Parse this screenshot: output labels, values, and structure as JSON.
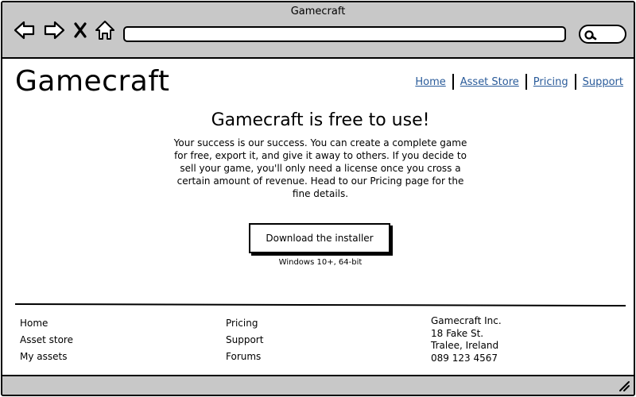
{
  "window": {
    "title": "Gamecraft"
  },
  "toolbar": {
    "icons": [
      "back-arrow-icon",
      "forward-arrow-icon",
      "close-icon",
      "home-icon",
      "search-icon"
    ],
    "address_value": ""
  },
  "header": {
    "logo": "Gamecraft",
    "nav": [
      {
        "label": "Home"
      },
      {
        "label": "Asset Store"
      },
      {
        "label": "Pricing"
      },
      {
        "label": "Support"
      }
    ],
    "link_color": "#2a5b9a"
  },
  "hero": {
    "title": "Gamecraft is free to use!",
    "body": "Your success is our success. You can create a complete game for free, export it, and give it away to others. If you decide to sell your game, you'll only need a license once you cross a certain amount of revenue. Head to our Pricing page for the fine details.",
    "download_label": "Download the installer",
    "download_note": "Windows 10+, 64-bit"
  },
  "footer": {
    "col1": [
      "Home",
      "Asset store",
      "My assets"
    ],
    "col2": [
      "Pricing",
      "Support",
      "Forums"
    ],
    "address": [
      "Gamecraft Inc.",
      "18 Fake St.",
      "Tralee, Ireland",
      "089 123 4567"
    ]
  },
  "colors": {
    "chrome": "#c8c8c8",
    "border": "#000000"
  }
}
